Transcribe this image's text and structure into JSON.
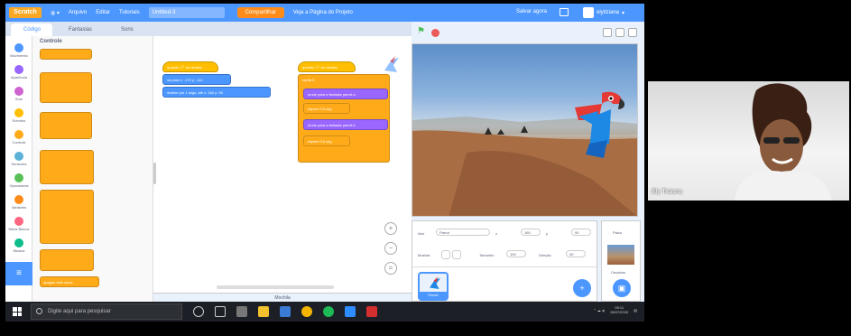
{
  "menubar": {
    "logo": "Scratch",
    "menu_globe": "◍ ▾",
    "menu_file": "Arquivo",
    "menu_edit": "Editar",
    "menu_tutorials": "Tutoriais",
    "project_title": "Untitled-3",
    "share_label": "Compartilhar",
    "see_project_label": "Veja a Página do Projeto",
    "saves_label": "Salvar agora",
    "username": "elytiziana"
  },
  "tabs": {
    "code": "Código",
    "costumes": "Fantasias",
    "sounds": "Sons"
  },
  "categories": [
    {
      "label": "Movimento",
      "color": "#4c97ff"
    },
    {
      "label": "Aparência",
      "color": "#9966ff"
    },
    {
      "label": "Som",
      "color": "#cf63cf"
    },
    {
      "label": "Eventos",
      "color": "#ffbf00"
    },
    {
      "label": "Controle",
      "color": "#ffab19"
    },
    {
      "label": "Sensores",
      "color": "#5cb1d6"
    },
    {
      "label": "Operadores",
      "color": "#59c059"
    },
    {
      "label": "Variáveis",
      "color": "#ff8c1a"
    },
    {
      "label": "Meus Blocos",
      "color": "#ff6680"
    },
    {
      "label": "Música",
      "color": "#0fbd8c"
    }
  ],
  "palette": {
    "title": "Controle",
    "bottom_block": "apague este clone"
  },
  "workspace": {
    "script1_hat": "quando 🏳 for clicado",
    "script1_b1": "vá para x: -170 y: -110",
    "script1_b2": "deslize por 1 segs. até x: 160 y: 90",
    "script2_hat": "quando 🏳 for clicado",
    "script2_repeat": "repita 5",
    "script2_b1": "mude para a fantasia parrot-a",
    "script2_b2": "espere 0.5 seg",
    "script2_b3": "mude para a fantasia parrot-b",
    "script2_b4": "espere 0.5 seg"
  },
  "backpack_label": "Mochila",
  "sprite_info": {
    "sprite_label": "Ator",
    "sprite_name": "Parrot",
    "x_label": "x",
    "x_value": "160",
    "y_label": "y",
    "y_value": "90",
    "show_label": "Mostrar",
    "size_label": "Tamanho",
    "size_value": "100",
    "direction_label": "Direção",
    "direction_value": "90"
  },
  "sprite_tile_name": "Parrot",
  "stage_pane": {
    "title": "Palco",
    "backdrops_label": "Cenários"
  },
  "taskbar": {
    "search_placeholder": "Digite aqui para pesquisar",
    "time": "09:11",
    "date": "28/07/2020"
  },
  "webcam": {
    "participant_name": "Ely Ticiana"
  }
}
